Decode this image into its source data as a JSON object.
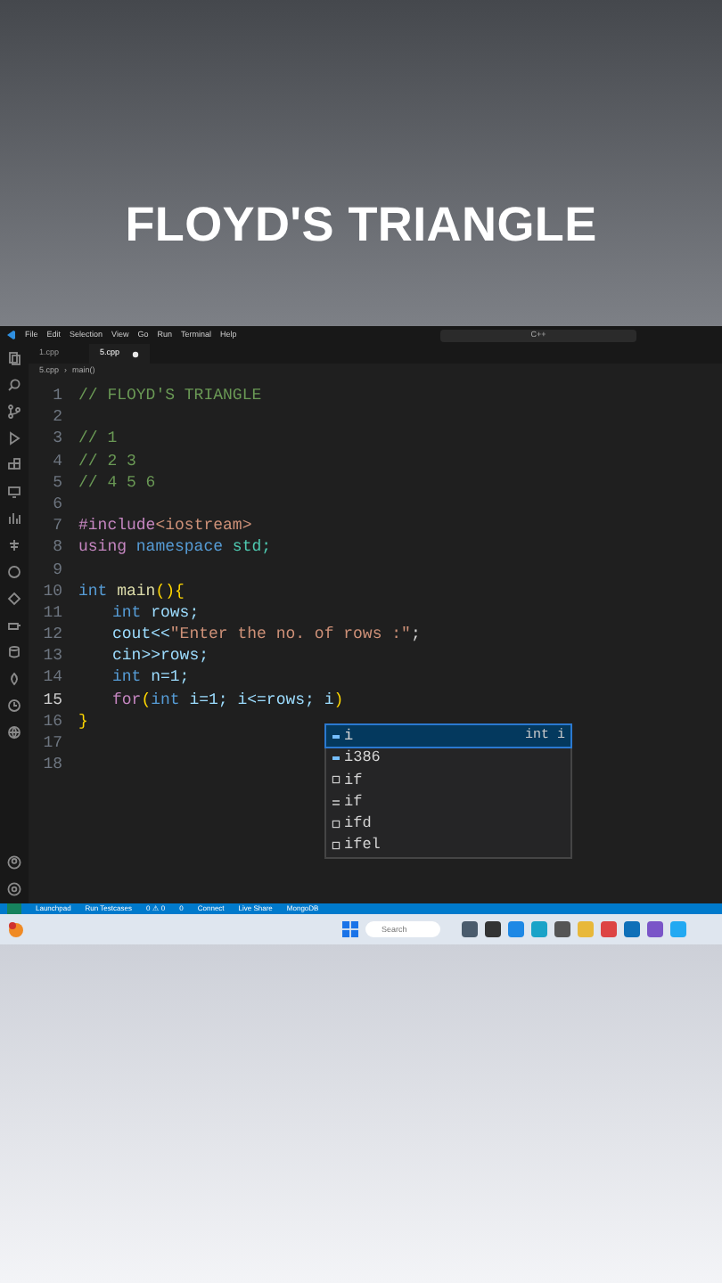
{
  "video_title": "FLOYD'S TRIANGLE",
  "editor": {
    "menu": [
      "File",
      "Edit",
      "Selection",
      "View",
      "Go",
      "Run",
      "Terminal",
      "Help"
    ],
    "command_center": "C++",
    "tabs": [
      {
        "label": "1.cpp",
        "selected": false
      },
      {
        "label": "5.cpp",
        "selected": true,
        "modified": true
      }
    ],
    "breadcrumb": [
      "5.cpp",
      "›",
      "main()"
    ],
    "lines": [
      {
        "number": "1",
        "current": false,
        "tokens": [
          {
            "text": "// FLOYD'S TRIANGLE",
            "kind": "comment"
          }
        ]
      },
      {
        "number": "2",
        "current": false
      },
      {
        "number": "3",
        "current": false,
        "tokens": [
          {
            "text": "// 1",
            "kind": "comment"
          }
        ]
      },
      {
        "number": "4",
        "current": false,
        "tokens": [
          {
            "text": "// 2 3",
            "kind": "comment"
          }
        ]
      },
      {
        "number": "5",
        "current": false,
        "tokens": [
          {
            "text": "// 4 5 6",
            "kind": "comment"
          }
        ]
      },
      {
        "number": "6",
        "current": false
      },
      {
        "number": "7",
        "current": false,
        "tokens": [
          {
            "text": "#include",
            "kind": "directive"
          },
          {
            "text": "<iostream>",
            "kind": "string"
          }
        ]
      },
      {
        "number": "8",
        "current": false,
        "tokens": [
          {
            "text": "using ",
            "kind": "directive"
          },
          {
            "text": "namespace ",
            "kind": "keyword"
          },
          {
            "text": "std;",
            "kind": "type"
          }
        ]
      },
      {
        "number": "9",
        "current": false
      },
      {
        "number": "10",
        "current": false,
        "tokens": [
          {
            "text": "int ",
            "kind": "keyword"
          },
          {
            "text": "main",
            "kind": "function"
          },
          {
            "text": "(){",
            "kind": "bracket"
          }
        ]
      },
      {
        "number": "11",
        "current": false,
        "indent": true,
        "tokens": [
          {
            "text": "int ",
            "kind": "keyword"
          },
          {
            "text": "rows;",
            "kind": "variable"
          }
        ]
      },
      {
        "number": "12",
        "current": false,
        "indent": true,
        "tokens": [
          {
            "text": "cout<<",
            "kind": "variable"
          },
          {
            "text": "\"Enter the no. of rows :\"",
            "kind": "string"
          },
          {
            "text": ";",
            "kind": "plain"
          }
        ]
      },
      {
        "number": "13",
        "current": false,
        "indent": true,
        "tokens": [
          {
            "text": "cin>>rows;",
            "kind": "variable"
          }
        ]
      },
      {
        "number": "14",
        "current": false,
        "indent": true,
        "tokens": [
          {
            "text": "int ",
            "kind": "keyword"
          },
          {
            "text": "n=1;",
            "kind": "variable"
          }
        ]
      },
      {
        "number": "15",
        "current": true,
        "indent": true,
        "tokens": [
          {
            "text": "for",
            "kind": "directive"
          },
          {
            "text": "(",
            "kind": "bracket"
          },
          {
            "text": "int ",
            "kind": "keyword"
          },
          {
            "text": "i=1; i<=rows; i",
            "kind": "variable"
          },
          {
            "text": ")",
            "kind": "bracket"
          }
        ]
      },
      {
        "number": "16",
        "current": false,
        "tokens": [
          {
            "text": "}",
            "kind": "bracket"
          }
        ]
      },
      {
        "number": "17",
        "current": false
      },
      {
        "number": "18",
        "current": false
      }
    ],
    "suggestions": [
      {
        "label": "i",
        "kind": "variable",
        "selected": true,
        "detail": "int i"
      },
      {
        "label": "i386",
        "kind": "variable",
        "selected": false
      },
      {
        "label": "if",
        "kind": "snippet",
        "selected": false
      },
      {
        "label": "if",
        "kind": "keyword",
        "selected": false
      },
      {
        "label": "ifd",
        "kind": "snippet",
        "selected": false
      },
      {
        "label": "ifel",
        "kind": "snippet",
        "selected": false
      }
    ],
    "status_bar": [
      "Launchpad",
      "Run Testcases",
      "0 ⚠ 0",
      "0",
      "Connect",
      "Live Share",
      "MongoDB"
    ]
  },
  "taskbar": {
    "search_placeholder": "Search"
  }
}
